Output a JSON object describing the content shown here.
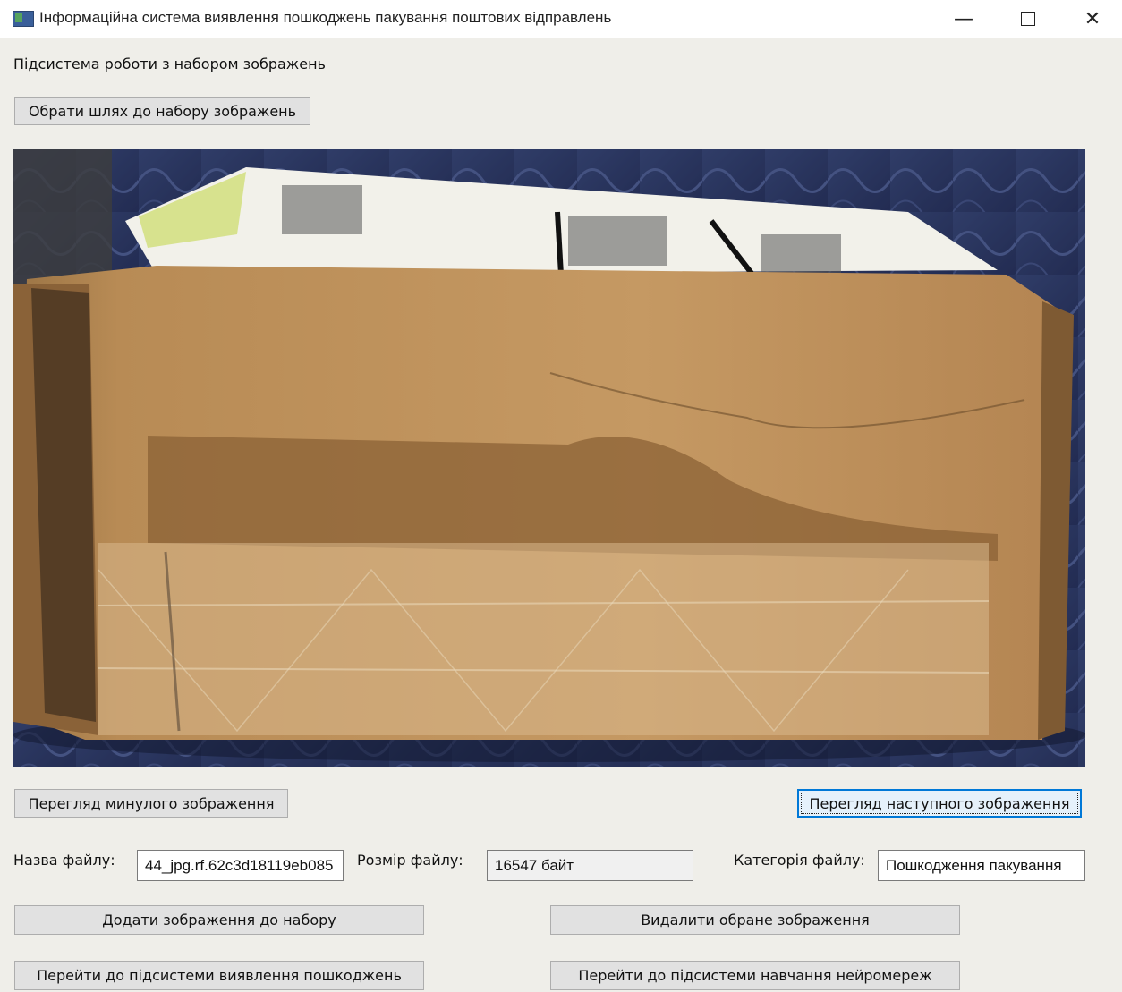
{
  "window": {
    "title": "Інформаційна система виявлення пошкоджень пакування поштових відправлень",
    "minimize_glyph": "—",
    "close_glyph": "✕"
  },
  "subsystem_label": "Підсистема роботи з набором зображень",
  "buttons": {
    "choose_path": "Обрати шлях до набору зображень",
    "prev_image": "Перегляд минулого зображення",
    "next_image": "Перегляд наступного зображення",
    "add_image": "Додати зображення до набору",
    "delete_image": "Видалити обране зображення",
    "go_detection": "Перейти до підсистеми виявлення пошкоджень",
    "go_training": "Перейти до підсистеми навчання нейромереж"
  },
  "file_info": {
    "name_label": "Назва файлу:",
    "name_value": "44_jpg.rf.62c3d18119eb085",
    "size_label": "Розмір файлу:",
    "size_value": "16547 байт",
    "category_label": "Категорія файлу:",
    "category_value": "Пошкодження пакування"
  },
  "icons": {
    "app": "app-window-icon",
    "minimize": "minimize-icon",
    "maximize": "maximize-icon",
    "close": "close-icon"
  },
  "colors": {
    "window_bg": "#efeee9",
    "focus_border": "#0078d7",
    "button_bg": "#e1e1e1"
  }
}
